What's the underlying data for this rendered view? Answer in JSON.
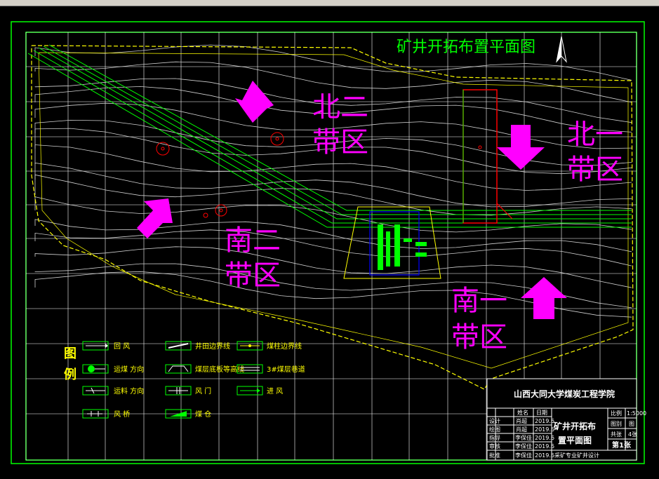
{
  "drawing": {
    "title": "矿井开拓布置平面图",
    "north_label": "N"
  },
  "zones": {
    "north_two": [
      "北二",
      "带区"
    ],
    "north_one": [
      "北一",
      "带区"
    ],
    "south_two": [
      "南二",
      "带区"
    ],
    "south_one": [
      "南一",
      "带区"
    ]
  },
  "legend": {
    "heading": [
      "图",
      "例"
    ],
    "items": [
      {
        "label": "回    风",
        "icon": "return-air-arrow-icon"
      },
      {
        "label": "井田边界线",
        "icon": "field-boundary-icon"
      },
      {
        "label": "煤柱边界线",
        "icon": "pillar-boundary-icon"
      },
      {
        "label": "运煤 方向",
        "icon": "coal-transport-icon"
      },
      {
        "label": "煤层底板等高线",
        "icon": "floor-contour-icon"
      },
      {
        "label": "3#煤层巷道",
        "icon": "roadway-icon"
      },
      {
        "label": "运料 方向",
        "icon": "material-transport-icon"
      },
      {
        "label": "风 门",
        "icon": "air-door-icon"
      },
      {
        "label": "进 风",
        "icon": "intake-air-arrow-icon"
      },
      {
        "label": "风 桥",
        "icon": "air-bridge-icon"
      },
      {
        "label": "煤 仓",
        "icon": "coal-bunker-icon"
      }
    ]
  },
  "title_block": {
    "institution": "山西大同大学煤炭工程学院",
    "drawing_name": [
      "矿井开拓布",
      "置平面图"
    ],
    "headers": [
      "姓名",
      "日期"
    ],
    "rows": [
      {
        "role": "设计",
        "name": "肖超",
        "date": "2019.6"
      },
      {
        "role": "绘图",
        "name": "肖超",
        "date": "2019.6"
      },
      {
        "role": "指导",
        "name": "李保佳",
        "date": "2019.6"
      },
      {
        "role": "审核",
        "name": "李保佳",
        "date": "2019.6"
      },
      {
        "role": "批准",
        "name": "李保佳",
        "date": "2019.6"
      }
    ],
    "scale_label": "比例",
    "scale_value": "1:5000",
    "type_label": "图别",
    "type_value": "图",
    "sheets_label": "共张",
    "sheets_value": "4张",
    "sheet_no": "第1张",
    "bottom_note": "采矿专业矿井设计"
  },
  "colors": {
    "frame": "#00ff00",
    "grid": "#ffffff",
    "boundary": "#ffff00",
    "zone_text": "#ff00ff",
    "shaft": "#ff0000",
    "station": "#0000ff"
  }
}
